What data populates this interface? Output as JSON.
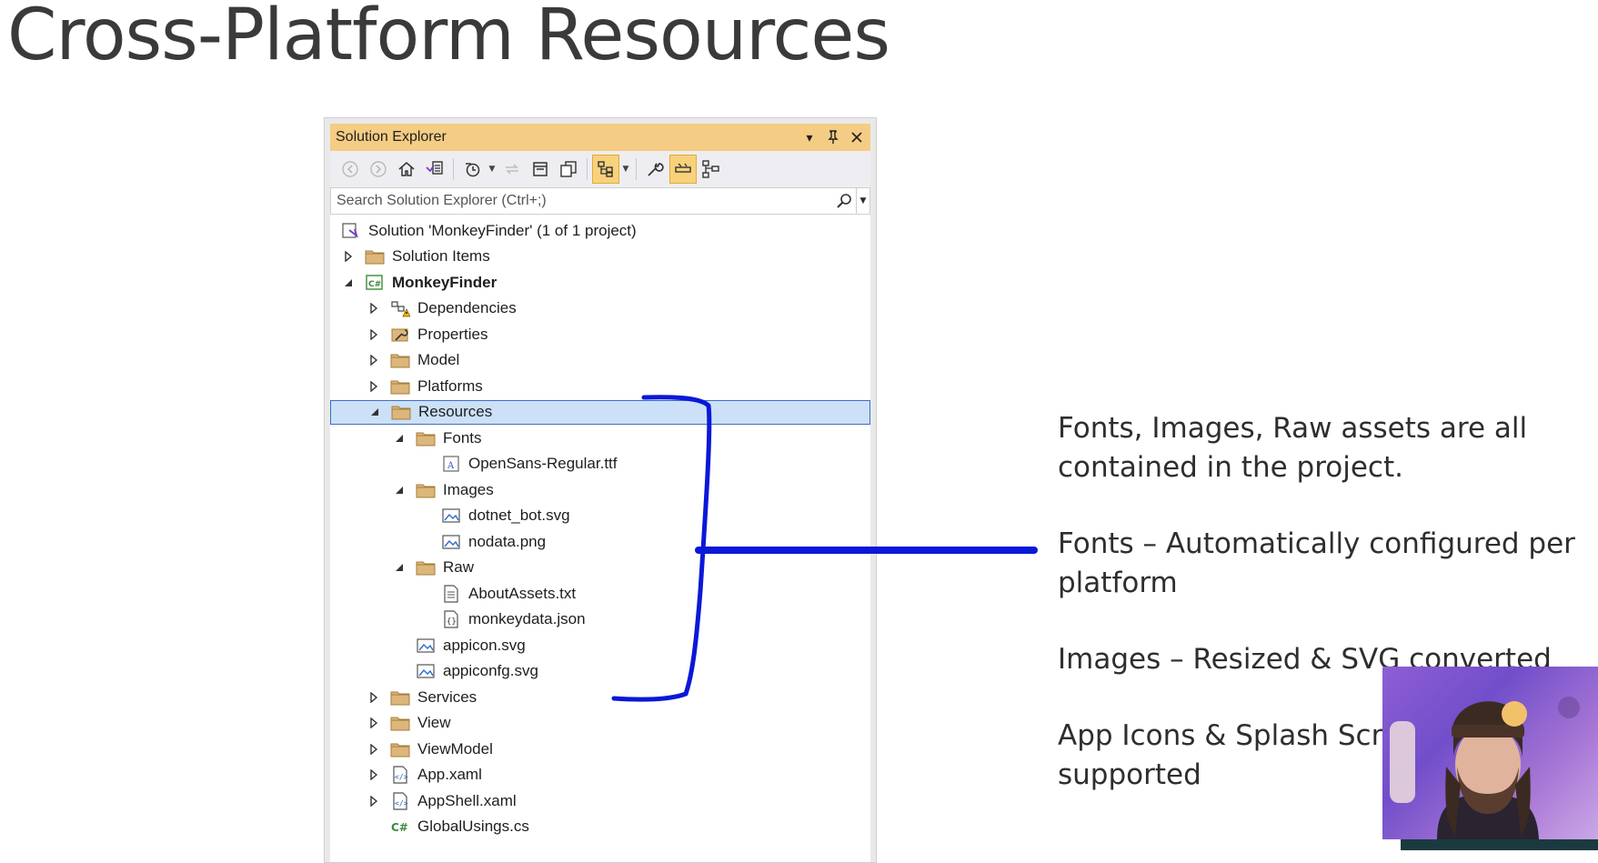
{
  "slide": {
    "title": "Cross-Platform Resources",
    "bullets": [
      "Fonts, Images, Raw assets are all contained in the project.",
      "Fonts – Automatically configured per platform",
      "Images – Resized & SVG converted",
      "App Icons & Splash Screens supported"
    ]
  },
  "solution_explorer": {
    "title": "Solution Explorer",
    "search_placeholder": "Search Solution Explorer (Ctrl+;)",
    "tree": [
      {
        "label": "Solution 'MonkeyFinder' (1 of 1 project)",
        "icon": "solution-icon"
      },
      {
        "label": "Solution Items",
        "icon": "folder-icon",
        "state": "collapsed"
      },
      {
        "label": "MonkeyFinder",
        "icon": "csharp-project-icon",
        "state": "expanded",
        "bold": true
      },
      {
        "label": "Dependencies",
        "icon": "dependencies-warning-icon",
        "state": "collapsed"
      },
      {
        "label": "Properties",
        "icon": "properties-icon",
        "state": "collapsed"
      },
      {
        "label": "Model",
        "icon": "folder-icon",
        "state": "collapsed"
      },
      {
        "label": "Platforms",
        "icon": "folder-icon",
        "state": "collapsed"
      },
      {
        "label": "Resources",
        "icon": "folder-icon",
        "state": "expanded",
        "selected": true
      },
      {
        "label": "Fonts",
        "icon": "folder-icon",
        "state": "expanded"
      },
      {
        "label": "OpenSans-Regular.ttf",
        "icon": "font-file-icon"
      },
      {
        "label": "Images",
        "icon": "folder-icon",
        "state": "expanded"
      },
      {
        "label": "dotnet_bot.svg",
        "icon": "image-file-icon"
      },
      {
        "label": "nodata.png",
        "icon": "image-file-icon"
      },
      {
        "label": "Raw",
        "icon": "folder-icon",
        "state": "expanded"
      },
      {
        "label": "AboutAssets.txt",
        "icon": "text-file-icon"
      },
      {
        "label": "monkeydata.json",
        "icon": "json-file-icon"
      },
      {
        "label": "appicon.svg",
        "icon": "image-file-icon"
      },
      {
        "label": "appiconfg.svg",
        "icon": "image-file-icon"
      },
      {
        "label": "Services",
        "icon": "folder-icon",
        "state": "collapsed"
      },
      {
        "label": "View",
        "icon": "folder-icon",
        "state": "collapsed"
      },
      {
        "label": "ViewModel",
        "icon": "folder-icon",
        "state": "collapsed"
      },
      {
        "label": "App.xaml",
        "icon": "xaml-file-icon",
        "state": "collapsed"
      },
      {
        "label": "AppShell.xaml",
        "icon": "xaml-file-icon",
        "state": "collapsed"
      },
      {
        "label": "GlobalUsings.cs",
        "icon": "csharp-file-icon"
      }
    ]
  },
  "colors": {
    "title_bar": "#f5cc84",
    "selection": "#cce0f7",
    "annotation_ink": "#0a18d8",
    "webcam_background": "#8f5fd6"
  }
}
